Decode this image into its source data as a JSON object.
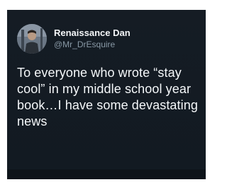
{
  "tweet": {
    "author": {
      "display_name": "Renaissance Dan",
      "handle": "@Mr_DrEsquire",
      "avatar_icon": "user-avatar"
    },
    "text": "To everyone who wrote “stay cool” in my middle school year book…I have some devastating news"
  },
  "colors": {
    "card_background": "#15202b",
    "primary_text": "#f5f8fa",
    "secondary_text": "#8899a6"
  }
}
